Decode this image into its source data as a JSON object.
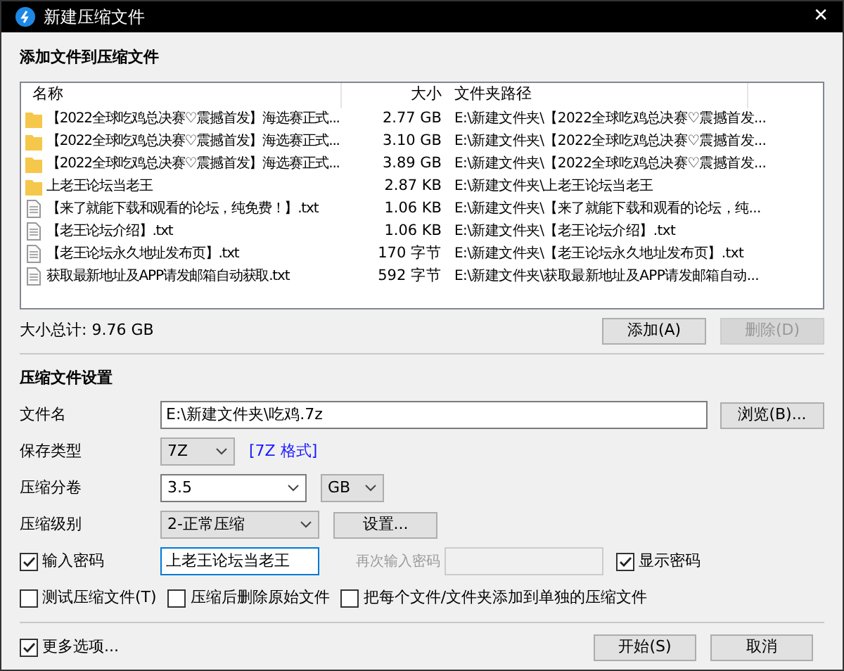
{
  "window": {
    "title": "新建压缩文件",
    "close": "✕"
  },
  "files_section": {
    "title": "添加文件到压缩文件",
    "columns": [
      "名称",
      "大小",
      "文件夹路径"
    ],
    "rows": [
      {
        "kind": "folder",
        "name": "【2022全球吃鸡总决赛♡震撼首发】海选赛正式...",
        "size": "2.77 GB",
        "path": "E:\\新建文件夹\\【2022全球吃鸡总决赛♡震撼首发..."
      },
      {
        "kind": "folder",
        "name": "【2022全球吃鸡总决赛♡震撼首发】海选赛正式...",
        "size": "3.10 GB",
        "path": "E:\\新建文件夹\\【2022全球吃鸡总决赛♡震撼首发..."
      },
      {
        "kind": "folder",
        "name": "【2022全球吃鸡总决赛♡震撼首发】海选赛正式...",
        "size": "3.89 GB",
        "path": "E:\\新建文件夹\\【2022全球吃鸡总决赛♡震撼首发..."
      },
      {
        "kind": "folder",
        "name": "上老王论坛当老王",
        "size": "2.87 KB",
        "path": "E:\\新建文件夹\\上老王论坛当老王"
      },
      {
        "kind": "file",
        "name": "【来了就能下载和观看的论坛，纯免费！】.txt",
        "size": "1.06 KB",
        "path": "E:\\新建文件夹\\【来了就能下载和观看的论坛，纯..."
      },
      {
        "kind": "file",
        "name": "【老王论坛介绍】.txt",
        "size": "1.06 KB",
        "path": "E:\\新建文件夹\\【老王论坛介绍】.txt"
      },
      {
        "kind": "file",
        "name": "【老王论坛永久地址发布页】.txt",
        "size": "170 字节",
        "path": "E:\\新建文件夹\\【老王论坛永久地址发布页】.txt"
      },
      {
        "kind": "file",
        "name": "获取最新地址及APP请发邮箱自动获取.txt",
        "size": "592 字节",
        "path": "E:\\新建文件夹\\获取最新地址及APP请发邮箱自动..."
      }
    ],
    "total": "大小总计: 9.76 GB",
    "buttons": [
      {
        "label": "添加(A)",
        "disabled": false
      },
      {
        "label": "删除(D)",
        "disabled": true
      }
    ]
  },
  "settings": {
    "title": "压缩文件设置",
    "filename": {
      "label": "文件名",
      "value": "E:\\新建文件夹\\吃鸡.7z",
      "browse": "浏览(B)..."
    },
    "save_type": {
      "label": "保存类型",
      "value": "7Z",
      "link": "[7Z 格式]"
    },
    "split": {
      "label": "压缩分卷",
      "value": "3.5",
      "unit": "GB"
    },
    "level": {
      "label": "压缩级别",
      "value": "2-正常压缩",
      "button": "设置..."
    },
    "password": {
      "label": "输入密码",
      "checked": true,
      "value": "上老王论坛当老王",
      "confirm_label": "再次输入密码",
      "show_label": "显示密码",
      "show_checked": true
    },
    "options": [
      {
        "label": "测试压缩文件(T)",
        "checked": false
      },
      {
        "label": "压缩后删除原始文件",
        "checked": false
      },
      {
        "label": "把每个文件/文件夹添加到单独的压缩文件",
        "checked": false
      }
    ]
  },
  "footer": {
    "more": {
      "label": "更多选项...",
      "checked": true
    },
    "buttons": [
      "开始(S)",
      "取消"
    ]
  }
}
